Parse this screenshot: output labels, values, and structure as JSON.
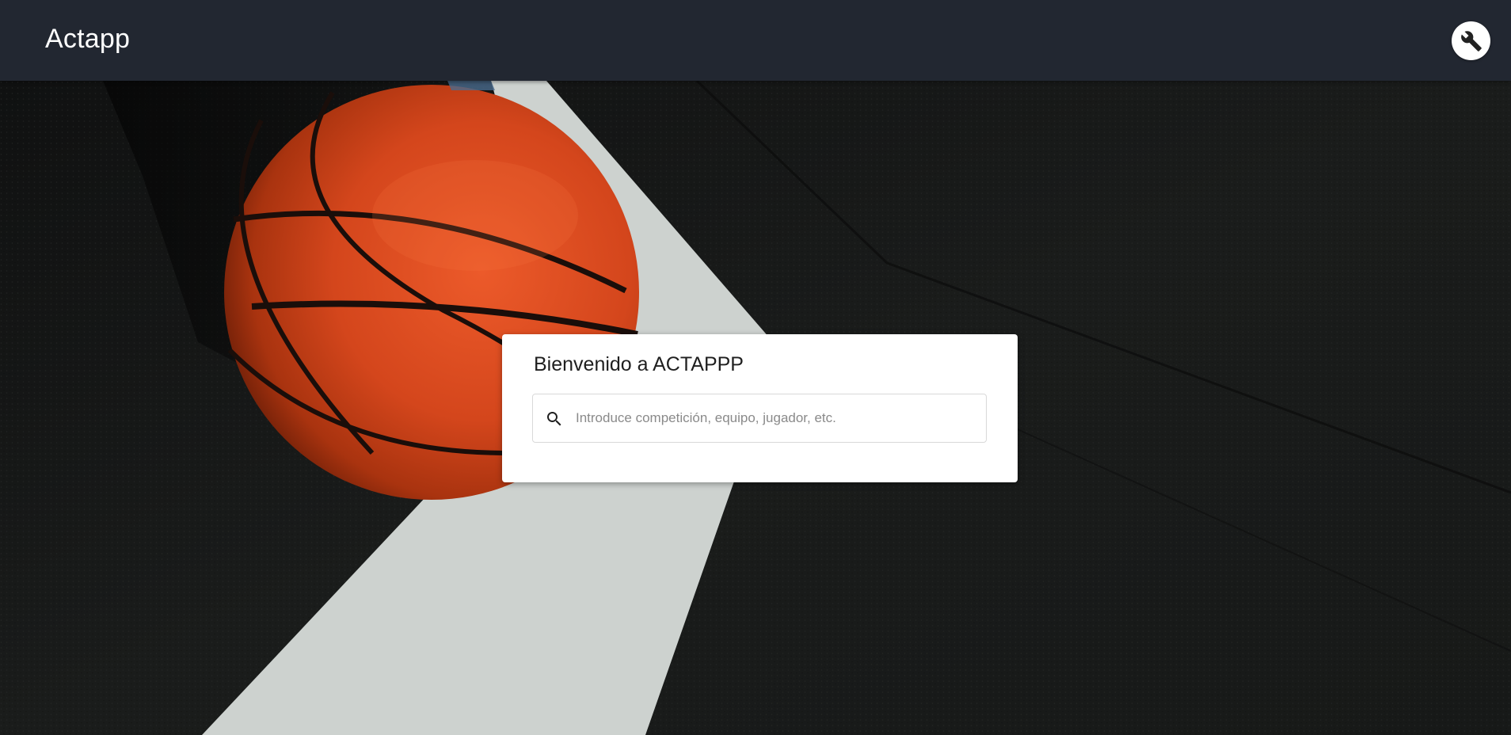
{
  "app_bar": {
    "title": "Actapp",
    "tools_icon": "wrench-icon"
  },
  "hero": {
    "background_image": "basketball-on-court"
  },
  "search_card": {
    "title": "Bienvenido a ACTAPPP",
    "search": {
      "icon": "search-icon",
      "value": "",
      "placeholder": "Introduce competición, equipo, jugador, etc."
    }
  },
  "colors": {
    "app_bar_bg": "#222731",
    "court": "#161817",
    "ball": "#d9481e",
    "line": "#cfd3d0"
  }
}
